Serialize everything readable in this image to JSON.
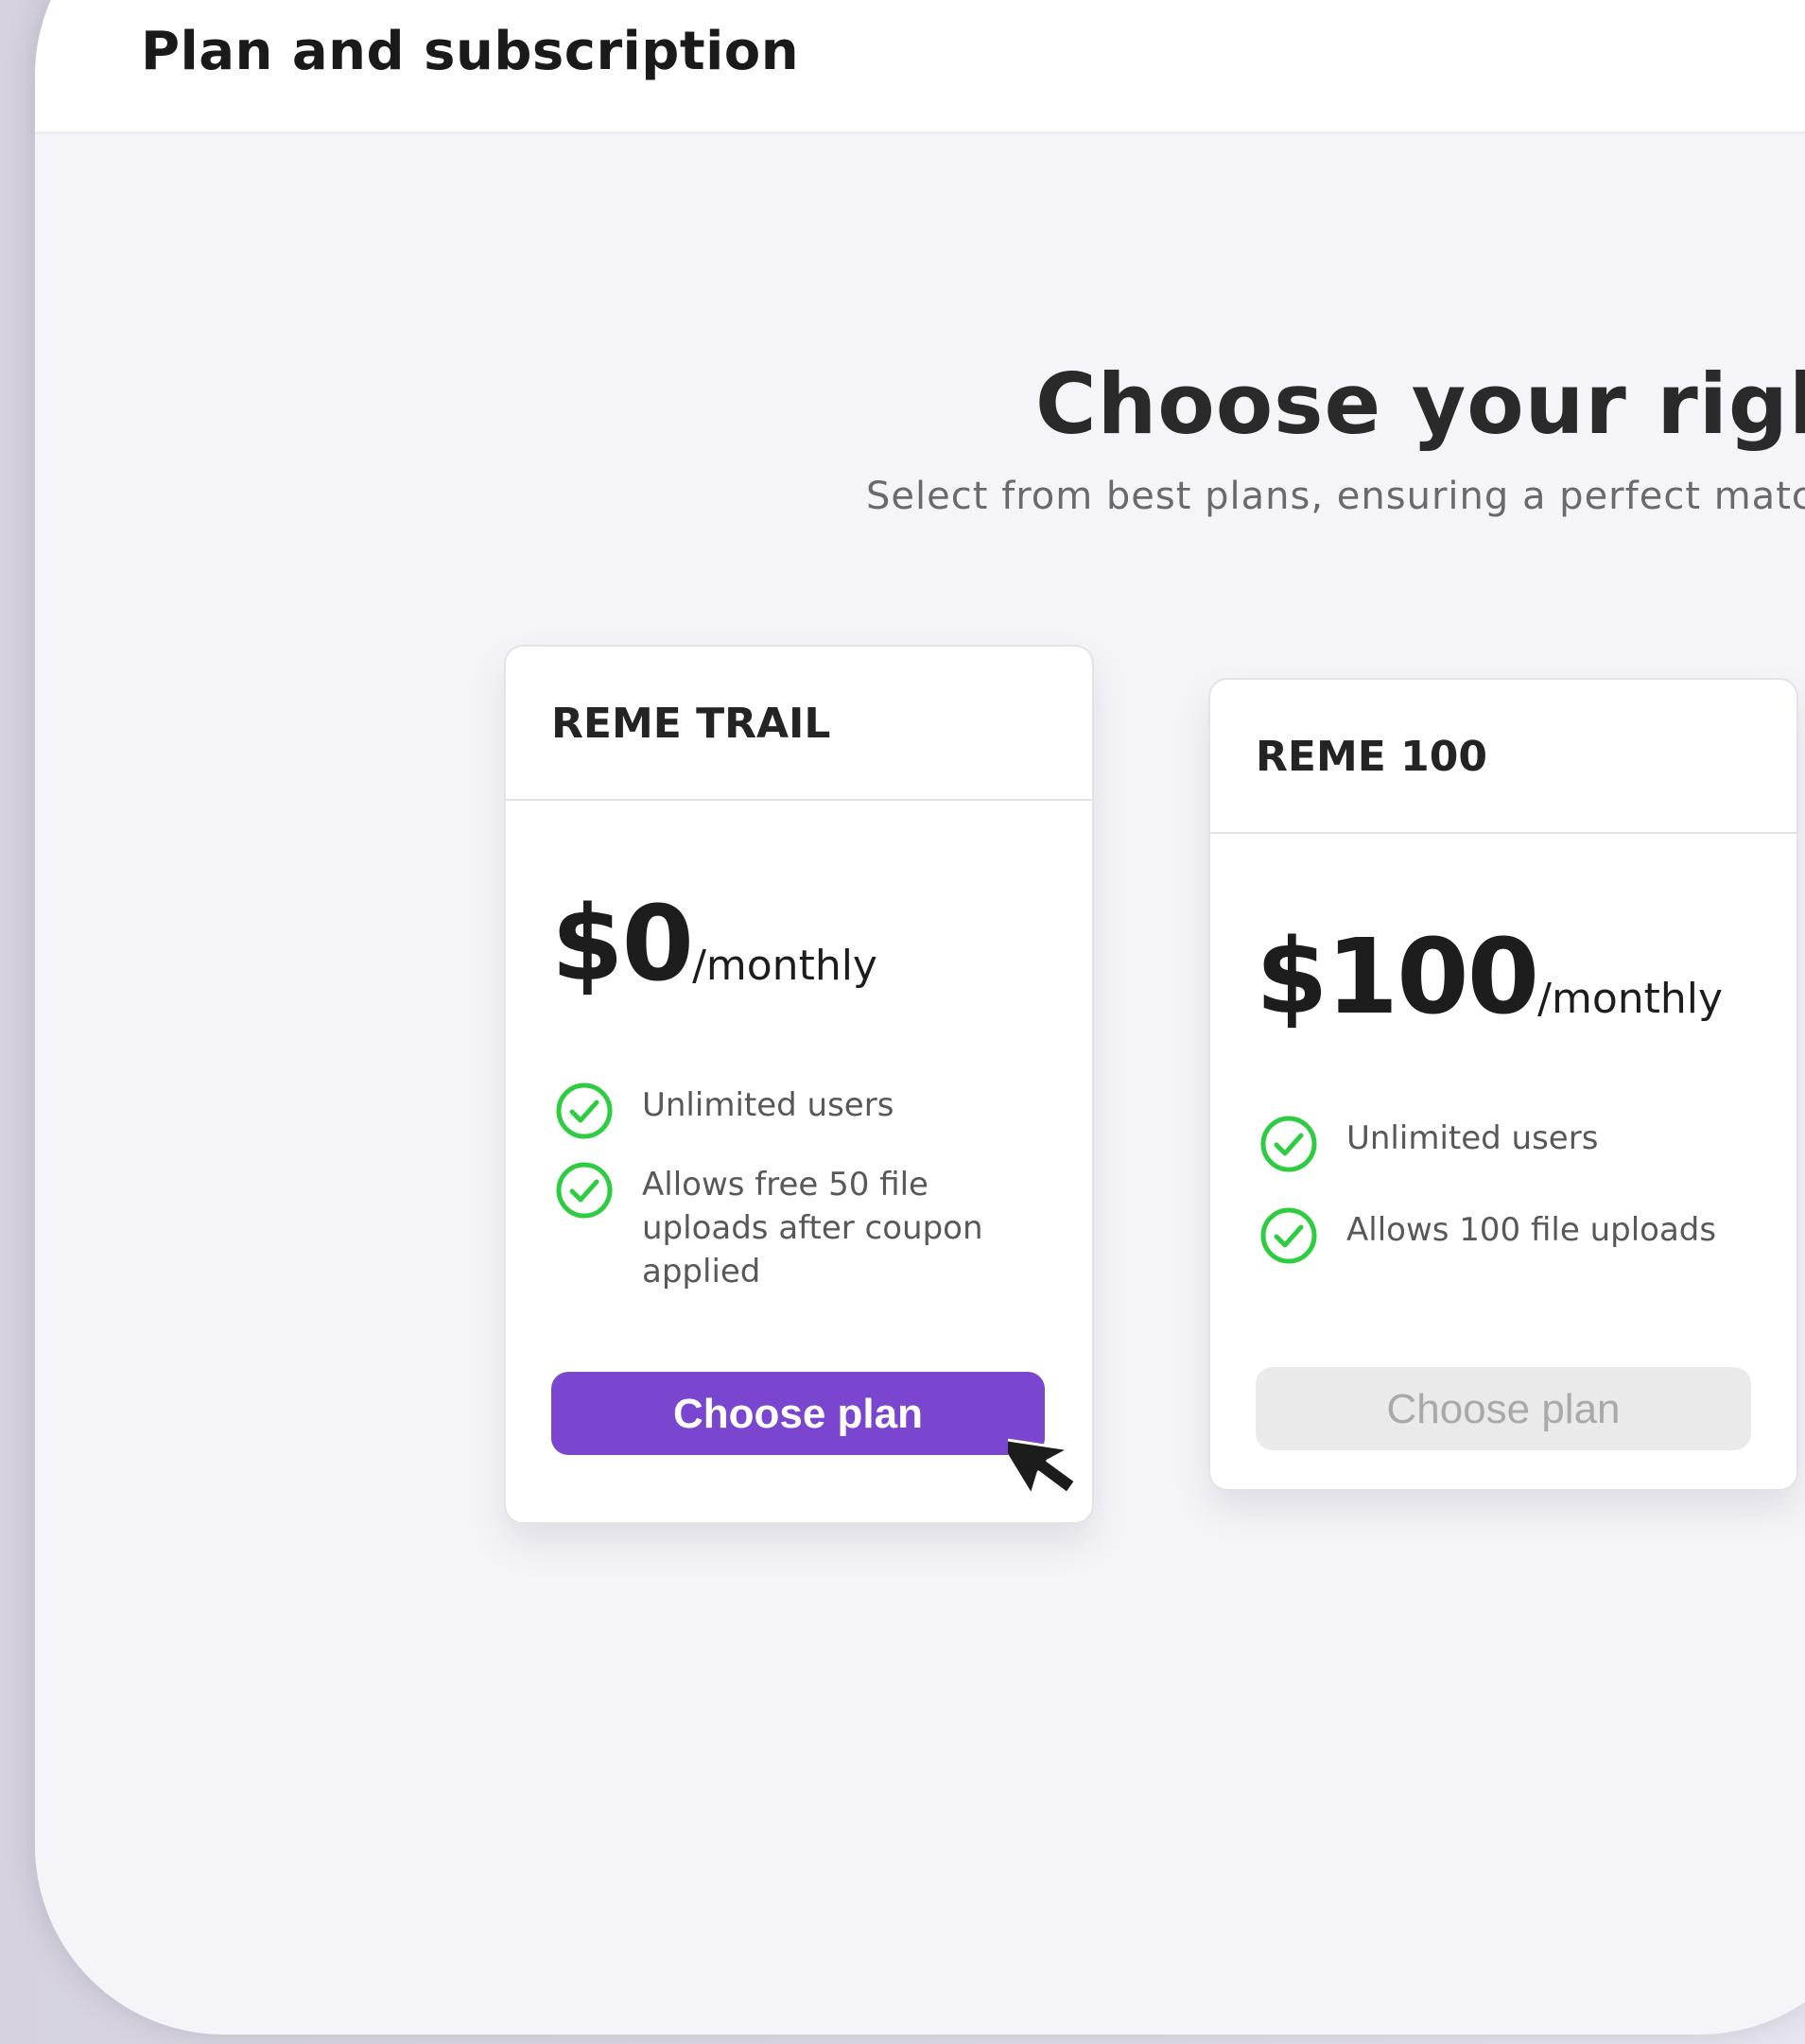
{
  "header": {
    "title": "Plan and subscription"
  },
  "hero": {
    "title": "Choose your right p",
    "subtitle": "Select from best plans, ensuring a perfect match. N"
  },
  "plans": [
    {
      "name": "REME TRAIL",
      "price": "$0",
      "period": "/monthly",
      "features": [
        "Unlimited users",
        "Allows free 50 file uploads after coupon applied"
      ],
      "button_label": "Choose plan",
      "button_state": "active"
    },
    {
      "name": "REME 100",
      "price": "$100",
      "period": "/monthly",
      "features": [
        "Unlimited users",
        "Allows 100 file uploads"
      ],
      "button_label": "Choose plan",
      "button_state": "disabled"
    }
  ],
  "colors": {
    "accent": "#7a45cf",
    "check": "#2ecc40",
    "disabled_button": "#eaeaea",
    "disabled_text": "#a9a9a9",
    "page_background": "#f5f5f9"
  },
  "icons": {
    "check": "check-circle-icon",
    "cursor": "mouse-pointer-icon"
  }
}
